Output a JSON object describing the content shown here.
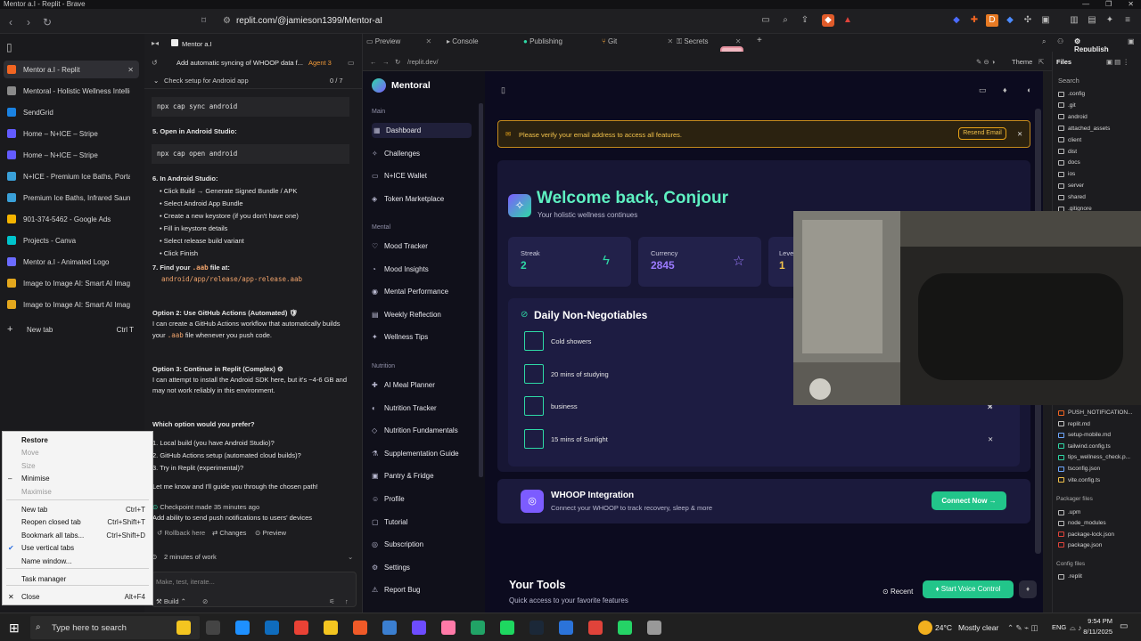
{
  "browser": {
    "window_title": "Mentor a.I - Replit - Brave",
    "url": "replit.com/@jamieson1399/Mentor-aI",
    "new_tab_label": "New tab",
    "new_tab_shortcut": "Ctrl T"
  },
  "vertical_tabs": [
    {
      "label": "Mentor a.I - Replit",
      "color": "#f26522",
      "active": true
    },
    {
      "label": "Mentoral - Holistic Wellness Intellig",
      "color": "#8a8a8a"
    },
    {
      "label": "SendGrid",
      "color": "#1a82e2"
    },
    {
      "label": "Home – N+ICE – Stripe",
      "color": "#635bff"
    },
    {
      "label": "Home – N+ICE – Stripe",
      "color": "#635bff"
    },
    {
      "label": "N+ICE - Premium Ice Baths, Portabl",
      "color": "#3aa0d8"
    },
    {
      "label": "Premium Ice Baths, Infrared Sauna",
      "color": "#3aa0d8"
    },
    {
      "label": "901-374-5462 - Google Ads",
      "color": "#f4b400"
    },
    {
      "label": "Projects - Canva",
      "color": "#00c4cc"
    },
    {
      "label": "Mentor a.I - Animated Logo",
      "color": "#6b6bff"
    },
    {
      "label": "Image to Image AI: Smart AI Image",
      "color": "#e3a71d"
    },
    {
      "label": "Image to Image AI: Smart AI Image",
      "color": "#e3a71d"
    }
  ],
  "context_menu": [
    {
      "label": "Restore",
      "shortcut": "",
      "disabled": false,
      "bold": true
    },
    {
      "label": "Move",
      "shortcut": "",
      "disabled": true
    },
    {
      "label": "Size",
      "shortcut": "",
      "disabled": true
    },
    {
      "label": "Minimise",
      "shortcut": "",
      "disabled": false
    },
    {
      "label": "Maximise",
      "shortcut": "",
      "disabled": true
    },
    {
      "label": "New tab",
      "shortcut": "Ctrl+T"
    },
    {
      "label": "Reopen closed tab",
      "shortcut": "Ctrl+Shift+T"
    },
    {
      "label": "Bookmark all tabs...",
      "shortcut": "Ctrl+Shift+D"
    },
    {
      "label": "Use vertical tabs",
      "shortcut": "",
      "checked": true
    },
    {
      "label": "Name window..."
    },
    {
      "label": "Task manager"
    },
    {
      "label": "Close",
      "shortcut": "Alt+F4"
    }
  ],
  "agent": {
    "tab_label": "Mentor a.I",
    "task_title": "Add automatic syncing of WHOOP data f...",
    "agent_badge": "Agent 3",
    "checklist": "Check setup for Android app",
    "checklist_count": "0 / 7",
    "code1": "npx cap sync android",
    "step5": "5. Open in Android Studio:",
    "code2": "npx cap open android",
    "step6": "6. In Android Studio:",
    "bullets": [
      "Click Build → Generate Signed Bundle / APK",
      "Select Android App Bundle",
      "Create a new keystore (if you don't have one)",
      "Fill in keystore details",
      "Select release build variant",
      "Click Finish"
    ],
    "step7a": "7. Find your",
    "step7b": ".aab",
    "step7c": "file at:",
    "aab_path": "android/app/release/app-release.aab",
    "opt2_title": "Option 2: Use GitHub Actions (Automated) 🛡",
    "opt2_l1": "I can create a GitHub Actions workflow that automatically builds",
    "opt2_l2a": "your",
    "opt2_l2b": ".aab",
    "opt2_l2c": "file whenever you push code.",
    "opt3_title": "Option 3: Continue in Replit (Complex) ⚙",
    "opt3_l1": "I can attempt to install the Android SDK here, but it's ~4-6 GB and",
    "opt3_l2": "may not work reliably in this environment.",
    "question": "Which option would you prefer?",
    "choices": [
      "1. Local build (you have Android Studio)?",
      "2. GitHub Actions setup (automated cloud builds)?",
      "3. Try in Replit (experimental)?"
    ],
    "closing": "Let me know and I'll guide you through the chosen path!",
    "checkpoint": "Checkpoint made 35 minutes ago",
    "checkpoint_msg": "Add ability to send push notifications to users' devices",
    "rollback": "Rollback here",
    "changes": "Changes",
    "preview": "Preview",
    "work": "2 minutes of work",
    "input_placeholder": "Make, test, iterate...",
    "build": "Build"
  },
  "panel_tabs": [
    "Preview",
    "Console",
    "Publishing",
    "Git",
    "Secrets"
  ],
  "preview_url": "/replit.dev/",
  "theme_label": "Theme",
  "app": {
    "brand": "Mentoral",
    "sections": [
      {
        "title": "Main",
        "items": [
          "Dashboard",
          "Challenges",
          "N+ICE Wallet",
          "Token Marketplace"
        ]
      },
      {
        "title": "Mental",
        "items": [
          "Mood Tracker",
          "Mood Insights",
          "Mental Performance",
          "Weekly Reflection",
          "Wellness Tips"
        ]
      },
      {
        "title": "Nutrition",
        "items": [
          "AI Meal Planner",
          "Nutrition Tracker",
          "Nutrition Fundamentals",
          "Supplementation Guide",
          "Pantry & Fridge"
        ]
      },
      {
        "title": "",
        "items": [
          "Profile",
          "Tutorial",
          "Subscription",
          "Settings",
          "Report Bug"
        ]
      }
    ],
    "banner_text": "Please verify your email address to access all features.",
    "resend": "Resend Email",
    "welcome": "Welcome back, Conjour",
    "welcome_sub": "Your holistic wellness continues",
    "stats": [
      {
        "label": "Streak",
        "value": "2"
      },
      {
        "label": "Currency",
        "value": "2845"
      },
      {
        "label": "Leve",
        "value": "1"
      }
    ],
    "dnn_title": "Daily Non-Negotiables",
    "dnn": [
      "Cold showers",
      "20 mins of studying",
      "business",
      "15 mins of Sunlight"
    ],
    "whoop_title": "WHOOP Integration",
    "whoop_sub": "Connect your WHOOP to track recovery, sleep & more",
    "connect": "Connect Now",
    "tools_title": "Your Tools",
    "tools_sub": "Quick access to your favorite features",
    "recent": "Recent",
    "voice": "Start Voice Control"
  },
  "files": {
    "title": "Files",
    "search": "Search",
    "items": [
      ".config",
      ".git",
      "android",
      "attached_assets",
      "client",
      "dist",
      "docs",
      "ios",
      "server",
      "shared",
      ".gitignore"
    ],
    "bottom": [
      "PUSH_NOTIFICATION...",
      "replit.md",
      "setup-mobile.md",
      "tailwind.config.ts",
      "tips_wellness_check.p...",
      "tsconfig.json",
      "vite.config.ts"
    ],
    "packager_title": "Packager files",
    "packager": [
      ".upm",
      "node_modules",
      "package-lock.json",
      "package.json"
    ],
    "config_title": "Config files",
    "config": [
      ".replit"
    ]
  },
  "taskbar": {
    "search": "Type here to search",
    "weather": "24°C",
    "weather_text": "Mostly clear",
    "lang": "ENG",
    "time": "9:54 PM",
    "date": "8/11/2025"
  },
  "colors": {
    "accent_teal": "#2ed9a6",
    "warning": "#e8a317",
    "purple": "#7c5cff",
    "green_btn": "#22c58a"
  }
}
